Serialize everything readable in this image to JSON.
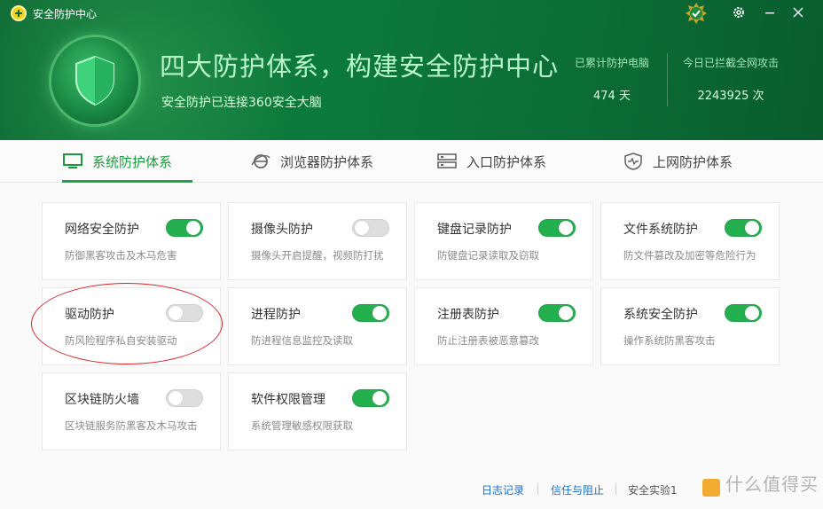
{
  "window": {
    "title": "安全防护中心"
  },
  "header": {
    "headline": "四大防护体系，构建安全防护中心",
    "subline": "安全防护已连接360安全大脑",
    "stats": [
      {
        "label": "已累计防护电脑",
        "value": "474 天"
      },
      {
        "label": "今日已拦截全网攻击",
        "value": "2243925 次"
      }
    ]
  },
  "tabs": [
    {
      "label": "系统防护体系",
      "icon": "monitor-icon",
      "active": true
    },
    {
      "label": "浏览器防护体系",
      "icon": "browser-icon",
      "active": false
    },
    {
      "label": "入口防护体系",
      "icon": "server-icon",
      "active": false
    },
    {
      "label": "上网防护体系",
      "icon": "shield-pulse-icon",
      "active": false
    }
  ],
  "cards": [
    {
      "name": "网络安全防护",
      "desc": "防御黑客攻击及木马危害",
      "on": true
    },
    {
      "name": "摄像头防护",
      "desc": "摄像头开启提醒，视频防打扰",
      "on": false
    },
    {
      "name": "键盘记录防护",
      "desc": "防键盘记录读取及窃取",
      "on": true
    },
    {
      "name": "文件系统防护",
      "desc": "防文件篡改及加密等危险行为",
      "on": true
    },
    {
      "name": "驱动防护",
      "desc": "防风险程序私自安装驱动",
      "on": false
    },
    {
      "name": "进程防护",
      "desc": "防进程信息监控及读取",
      "on": true
    },
    {
      "name": "注册表防护",
      "desc": "防止注册表被恶意篡改",
      "on": true
    },
    {
      "name": "系统安全防护",
      "desc": "操作系统防黑客攻击",
      "on": true
    },
    {
      "name": "区块链防火墙",
      "desc": "区块链服务防黑客及木马攻击",
      "on": false
    },
    {
      "name": "软件权限管理",
      "desc": "系统管理敏感权限获取",
      "on": true
    }
  ],
  "footer": {
    "log": "日志记录",
    "trust": "信任与阻止",
    "lab": "安全实验1",
    "watermark": "什么值得买"
  },
  "colors": {
    "accent": "#1ea446",
    "header": "#0c7a3c",
    "annotation": "#d8262b"
  }
}
